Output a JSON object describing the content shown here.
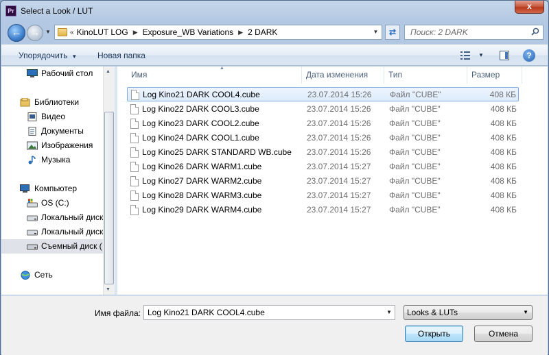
{
  "window": {
    "title": "Select a Look / LUT",
    "app_badge": "Pr",
    "close_label": "x"
  },
  "address": {
    "crumbs": [
      "KinoLUT LOG",
      "Exposure_WB Variations",
      "2 DARK"
    ]
  },
  "search": {
    "placeholder": "Поиск: 2 DARK"
  },
  "toolbar": {
    "organize_label": "Упорядочить",
    "new_folder_label": "Новая папка",
    "help_label": "?"
  },
  "nav": {
    "items": [
      {
        "label": "Рабочий стол",
        "icon": "desktop-icon"
      },
      {
        "label": "Библиотеки",
        "icon": "libraries-icon"
      },
      {
        "label": "Видео",
        "icon": "video-icon"
      },
      {
        "label": "Документы",
        "icon": "documents-icon"
      },
      {
        "label": "Изображения",
        "icon": "pictures-icon"
      },
      {
        "label": "Музыка",
        "icon": "music-icon"
      },
      {
        "label": "Компьютер",
        "icon": "computer-icon"
      },
      {
        "label": "OS (C:)",
        "icon": "drive-icon"
      },
      {
        "label": "Локальный диск",
        "icon": "drive-icon"
      },
      {
        "label": "Локальный диск",
        "icon": "drive-icon"
      },
      {
        "label": "Съемный диск (",
        "icon": "removable-drive-icon"
      },
      {
        "label": "Сеть",
        "icon": "network-icon"
      }
    ]
  },
  "columns": {
    "name": "Имя",
    "date": "Дата изменения",
    "type": "Тип",
    "size": "Размер"
  },
  "files": [
    {
      "name": "Log Kino21 DARK COOL4.cube",
      "date": "23.07.2014 15:26",
      "type": "Файл \"CUBE\"",
      "size": "408 КБ"
    },
    {
      "name": "Log Kino22 DARK COOL3.cube",
      "date": "23.07.2014 15:26",
      "type": "Файл \"CUBE\"",
      "size": "408 КБ"
    },
    {
      "name": "Log Kino23 DARK COOL2.cube",
      "date": "23.07.2014 15:26",
      "type": "Файл \"CUBE\"",
      "size": "408 КБ"
    },
    {
      "name": "Log Kino24 DARK COOL1.cube",
      "date": "23.07.2014 15:26",
      "type": "Файл \"CUBE\"",
      "size": "408 КБ"
    },
    {
      "name": "Log Kino25 DARK STANDARD WB.cube",
      "date": "23.07.2014 15:26",
      "type": "Файл \"CUBE\"",
      "size": "408 КБ"
    },
    {
      "name": "Log Kino26 DARK WARM1.cube",
      "date": "23.07.2014 15:27",
      "type": "Файл \"CUBE\"",
      "size": "408 КБ"
    },
    {
      "name": "Log Kino27 DARK WARM2.cube",
      "date": "23.07.2014 15:27",
      "type": "Файл \"CUBE\"",
      "size": "408 КБ"
    },
    {
      "name": "Log Kino28 DARK WARM3.cube",
      "date": "23.07.2014 15:27",
      "type": "Файл \"CUBE\"",
      "size": "408 КБ"
    },
    {
      "name": "Log Kino29 DARK WARM4.cube",
      "date": "23.07.2014 15:27",
      "type": "Файл \"CUBE\"",
      "size": "408 КБ"
    }
  ],
  "footer": {
    "filename_label": "Имя файла:",
    "filename_value": "Log Kino21 DARK COOL4.cube",
    "filetype_value": "Looks & LUTs",
    "open_label": "Открыть",
    "cancel_label": "Отмена"
  },
  "colors": {
    "accent": "#3c7fb1",
    "selection_border": "#84acdd",
    "title_bar": "#b3c8e2",
    "close_red": "#c75d43"
  }
}
